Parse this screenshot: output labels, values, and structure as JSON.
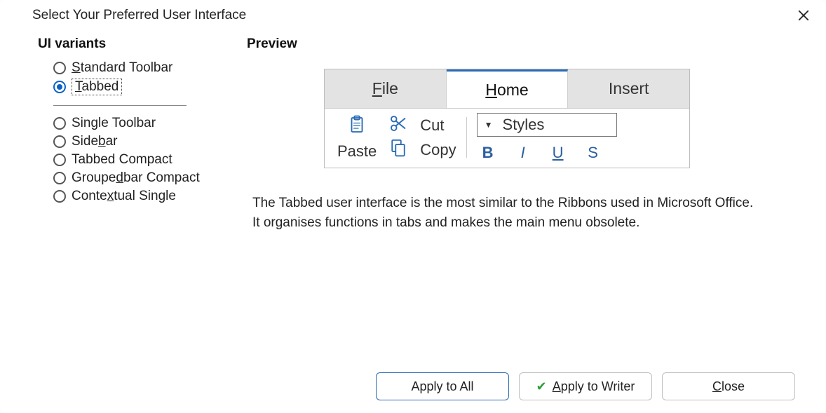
{
  "dialog": {
    "title": "Select Your Preferred User Interface"
  },
  "left": {
    "heading": "UI variants",
    "group1": [
      {
        "label": "Standard Toolbar",
        "underline_index": 0,
        "selected": false
      },
      {
        "label": "Tabbed",
        "underline_index": 0,
        "selected": true
      }
    ],
    "group2": [
      {
        "label": "Single Toolbar",
        "underline_index": -1
      },
      {
        "label": "Sidebar",
        "underline_index": 4
      },
      {
        "label": "Tabbed Compact",
        "underline_index": -1
      },
      {
        "label": "Groupedbar Compact",
        "underline_index": 6
      },
      {
        "label": "Contextual Single",
        "underline_index": 5
      }
    ]
  },
  "right": {
    "heading": "Preview",
    "tabs": [
      {
        "label": "File",
        "underline_index": 0,
        "active": false
      },
      {
        "label": "Home",
        "underline_index": 0,
        "active": true
      },
      {
        "label": "Insert",
        "underline_index": -1,
        "active": false
      }
    ],
    "ribbon": {
      "paste": "Paste",
      "cut": "Cut",
      "copy": "Copy",
      "styles": "Styles",
      "bold": "B",
      "italic": "I",
      "underline": "U",
      "strike": "S"
    },
    "description": "The Tabbed user interface is the most similar to the Ribbons used in Microsoft Office. It organises functions in tabs and makes the main menu obsolete."
  },
  "buttons": {
    "apply_all": "Apply to All",
    "apply_writer": "Apply to Writer",
    "close": "Close"
  }
}
